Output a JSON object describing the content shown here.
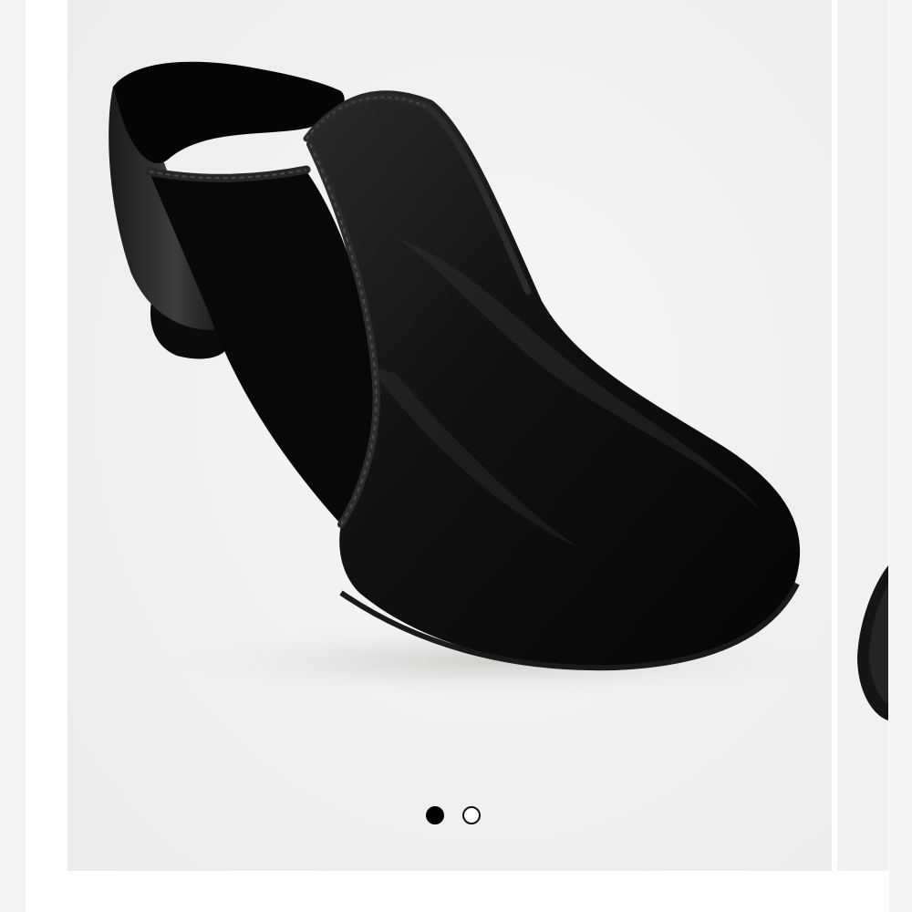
{
  "carousel": {
    "current_slide": 1,
    "total_slides": 2,
    "slides": [
      {
        "image": "black-leather-slip-on-jazz-shoe",
        "state": "active"
      },
      {
        "image": "black-leather-slip-on-jazz-shoe",
        "state": "peek"
      }
    ],
    "dots": [
      {
        "state": "active"
      },
      {
        "state": "inactive"
      }
    ]
  },
  "colors": {
    "background": "#ffffff",
    "slide_background": "#f2f1f0",
    "shoe_leather": "#0d0d0d",
    "dot_active": "#000000",
    "dot_inactive_border": "#111111"
  }
}
